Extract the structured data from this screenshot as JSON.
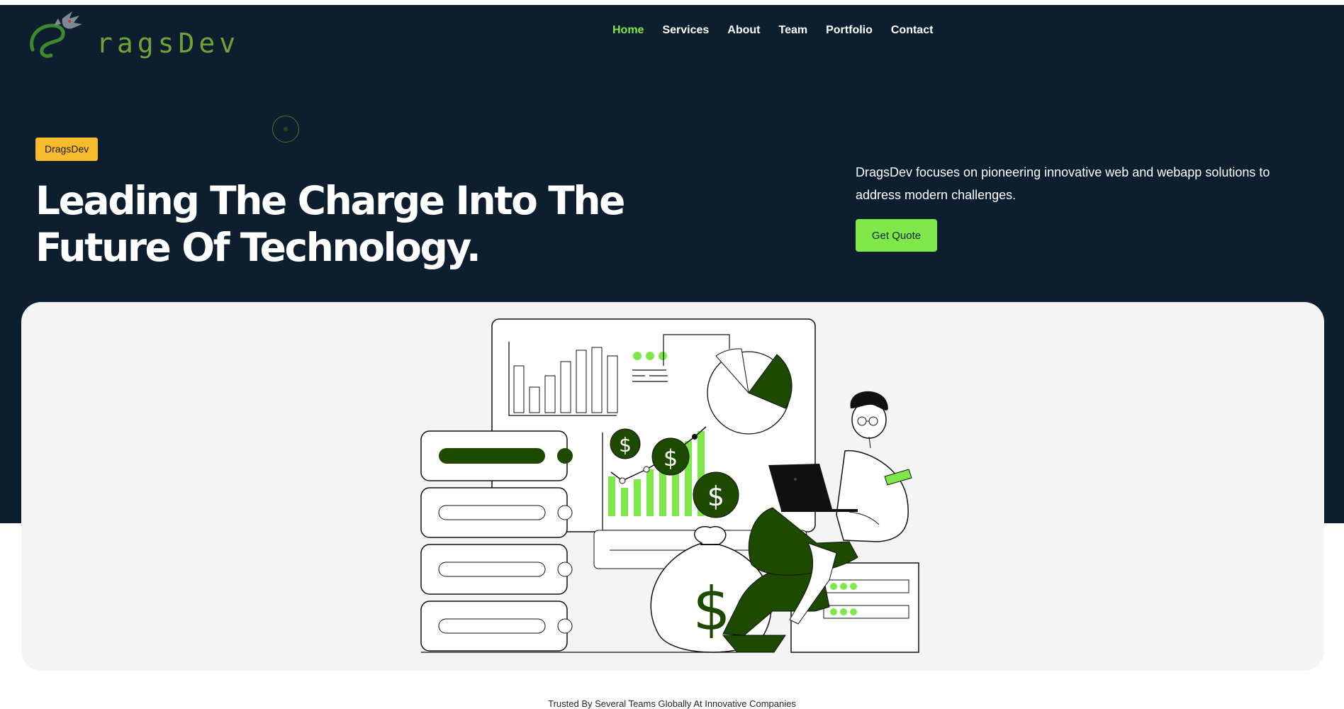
{
  "brand": {
    "name": "ragsDev",
    "logo_icon": "dragon-logo-icon"
  },
  "nav": {
    "items": [
      {
        "label": "Home",
        "active": true
      },
      {
        "label": "Services",
        "active": false
      },
      {
        "label": "About",
        "active": false
      },
      {
        "label": "Team",
        "active": false
      },
      {
        "label": "Portfolio",
        "active": false
      },
      {
        "label": "Contact",
        "active": false
      }
    ]
  },
  "hero": {
    "badge": "DragsDev",
    "headline": "Leading The Charge Into The Future Of Technology.",
    "description": "DragsDev focuses on pioneering innovative web and webapp solutions to address modern challenges.",
    "cta_label": "Get Quote"
  },
  "trusted_text": "Trusted By Several Teams Globally At Innovative Companies",
  "colors": {
    "hero_bg": "#0d1f2e",
    "accent_green": "#7ee84a",
    "dark_green": "#1e4a00",
    "badge_yellow": "#f9bb2e"
  }
}
